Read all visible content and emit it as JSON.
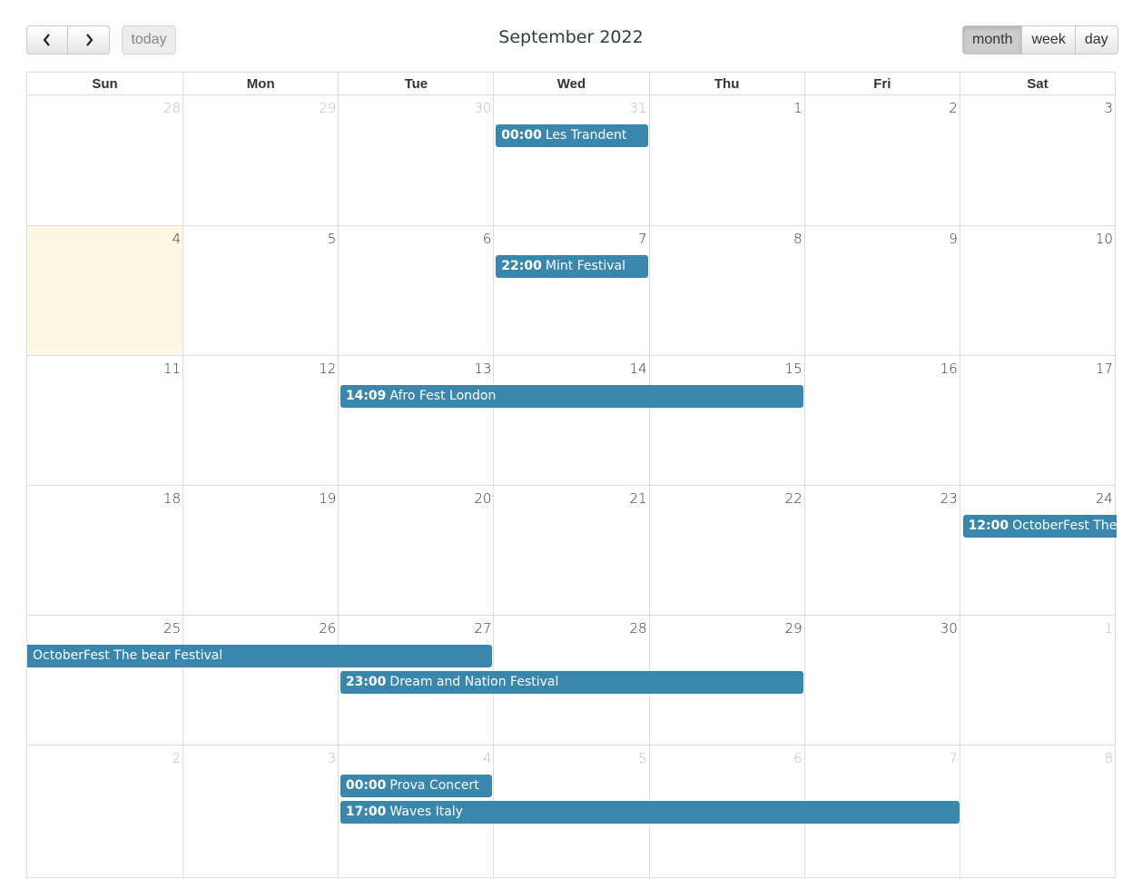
{
  "toolbar": {
    "prev_icon": "chevron-left-icon",
    "next_icon": "chevron-right-icon",
    "today_label": "today",
    "title": "September 2022",
    "views": [
      {
        "label": "month",
        "active": true
      },
      {
        "label": "week",
        "active": false
      },
      {
        "label": "day",
        "active": false
      }
    ]
  },
  "calendar": {
    "weekdays": [
      "Sun",
      "Mon",
      "Tue",
      "Wed",
      "Thu",
      "Fri",
      "Sat"
    ],
    "weeks": [
      {
        "days": [
          {
            "n": "28",
            "other": true
          },
          {
            "n": "29",
            "other": true
          },
          {
            "n": "30",
            "other": true
          },
          {
            "n": "31",
            "other": true
          },
          {
            "n": "1"
          },
          {
            "n": "2"
          },
          {
            "n": "3"
          }
        ]
      },
      {
        "days": [
          {
            "n": "4",
            "today": true
          },
          {
            "n": "5"
          },
          {
            "n": "6"
          },
          {
            "n": "7"
          },
          {
            "n": "8"
          },
          {
            "n": "9"
          },
          {
            "n": "10"
          }
        ]
      },
      {
        "days": [
          {
            "n": "11"
          },
          {
            "n": "12"
          },
          {
            "n": "13"
          },
          {
            "n": "14"
          },
          {
            "n": "15"
          },
          {
            "n": "16"
          },
          {
            "n": "17"
          }
        ]
      },
      {
        "days": [
          {
            "n": "18"
          },
          {
            "n": "19"
          },
          {
            "n": "20"
          },
          {
            "n": "21"
          },
          {
            "n": "22"
          },
          {
            "n": "23"
          },
          {
            "n": "24"
          }
        ]
      },
      {
        "days": [
          {
            "n": "25"
          },
          {
            "n": "26"
          },
          {
            "n": "27"
          },
          {
            "n": "28"
          },
          {
            "n": "29"
          },
          {
            "n": "30"
          },
          {
            "n": "1",
            "other": true
          }
        ]
      },
      {
        "days": [
          {
            "n": "2",
            "other": true
          },
          {
            "n": "3",
            "other": true
          },
          {
            "n": "4",
            "other": true
          },
          {
            "n": "5",
            "other": true
          },
          {
            "n": "6",
            "other": true
          },
          {
            "n": "7",
            "other": true
          },
          {
            "n": "8",
            "other": true
          }
        ]
      }
    ],
    "events": [
      {
        "week": 0,
        "start": 3,
        "span": 1,
        "level": 0,
        "time": "00:00",
        "title": "Les Trandent"
      },
      {
        "week": 1,
        "start": 3,
        "span": 1,
        "level": 0,
        "time": "22:00",
        "title": "Mint Festival"
      },
      {
        "week": 2,
        "start": 2,
        "span": 3,
        "level": 0,
        "time": "14:09",
        "title": "Afro Fest London"
      },
      {
        "week": 3,
        "start": 6,
        "span": 1,
        "level": 0,
        "time": "12:00",
        "title": "OctoberFest The bear Festival",
        "continues": "right"
      },
      {
        "week": 4,
        "start": 0,
        "span": 3,
        "level": 0,
        "time": "",
        "title": "OctoberFest The bear Festival",
        "continues": "left"
      },
      {
        "week": 4,
        "start": 2,
        "span": 3,
        "level": 1,
        "time": "23:00",
        "title": "Dream and Nation Festival"
      },
      {
        "week": 5,
        "start": 2,
        "span": 1,
        "level": 0,
        "time": "00:00",
        "title": "Prova Concert"
      },
      {
        "week": 5,
        "start": 2,
        "span": 4,
        "level": 1,
        "time": "17:00",
        "title": "Waves Italy"
      }
    ]
  }
}
